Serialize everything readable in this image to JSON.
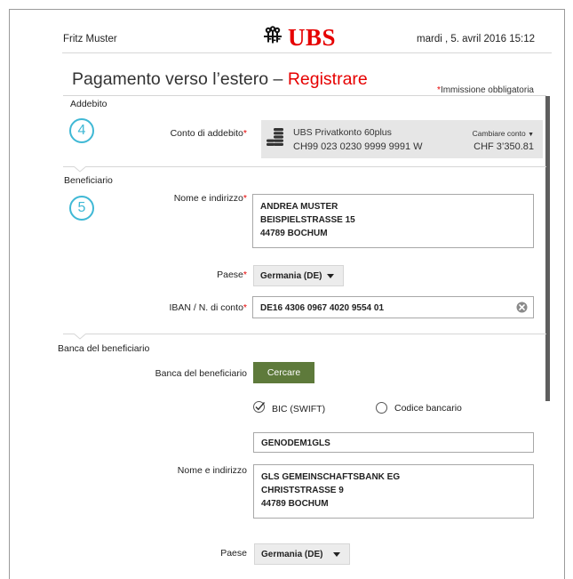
{
  "header": {
    "user_name": "Fritz Muster",
    "brand": "UBS",
    "datetime": "mardi , 5. avril 2016 15:12"
  },
  "page": {
    "title_main": "Pagamento verso l’estero – ",
    "title_action": "Registrare",
    "required_star": "*",
    "required_note": "Immissione obbligatoria"
  },
  "sections": {
    "debit": {
      "title": "Addebito",
      "step": "4",
      "account_label": "Conto di addebito",
      "account_name": "UBS Privatkonto 60plus",
      "account_iban": "CH99 023 0230 9999 9991 W",
      "change_account": "Cambiare conto",
      "balance": "CHF 3’350.81"
    },
    "beneficiary": {
      "title": "Beneficiario",
      "step": "5",
      "name_label": "Nome e indirizzo",
      "name_lines": [
        "ANDREA MUSTER",
        "BEISPIELSTRASSE 15",
        "44789 BOCHUM"
      ],
      "country_label": "Paese",
      "country_value": "Germania (DE)",
      "iban_label": "IBAN / N. di conto",
      "iban_value": "DE16 4306 0967 4020 9554 01"
    },
    "bank": {
      "title": "Banca del beneficiario",
      "bank_label": "Banca del beneficiario",
      "search_button": "Cercare",
      "bic_option": "BIC (SWIFT)",
      "bank_code_option": "Codice bancario",
      "bic_value": "GENODEM1GLS",
      "name_label": "Nome e indirizzo",
      "name_lines": [
        "GLS GEMEINSCHAFTSBANK EG",
        "CHRISTSTRASSE 9",
        "44789 BOCHUM"
      ],
      "country_label": "Paese",
      "country_value": "Germania (DE)"
    }
  },
  "colors": {
    "brand_red": "#e60000",
    "step_blue": "#3fb8d5",
    "button_green": "#5e7a3b"
  },
  "icons": {
    "logo": "ubs-keys-icon",
    "account": "coins-stack-icon",
    "clear": "clear-circle-x-icon",
    "dropdown": "caret-down-icon",
    "checked": "checkmark-icon",
    "radio": "radio-circle-icon"
  }
}
